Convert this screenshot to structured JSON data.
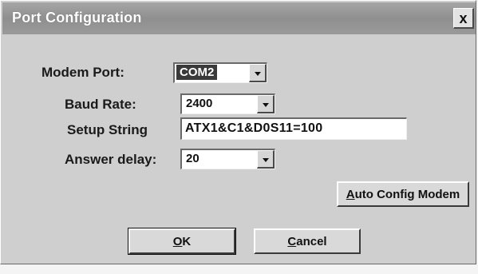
{
  "window": {
    "title": "Port Configuration",
    "close_glyph": "x"
  },
  "fields": {
    "modem_port": {
      "label": "Modem Port:",
      "value": "COM2"
    },
    "baud_rate": {
      "label": "Baud Rate:",
      "value": "2400"
    },
    "setup_string": {
      "label": "Setup String",
      "value": "ATX1&C1&D0S11=100"
    },
    "answer_delay": {
      "label": "Answer delay:",
      "value": "20"
    }
  },
  "buttons": {
    "auto_config": {
      "hotkey": "A",
      "rest": "uto Config Modem"
    },
    "ok": {
      "hotkey": "O",
      "rest": "K"
    },
    "cancel": {
      "hotkey": "C",
      "rest": "ancel"
    }
  },
  "icons": {
    "dropdown": "chevron-down-icon",
    "close": "close-icon"
  }
}
